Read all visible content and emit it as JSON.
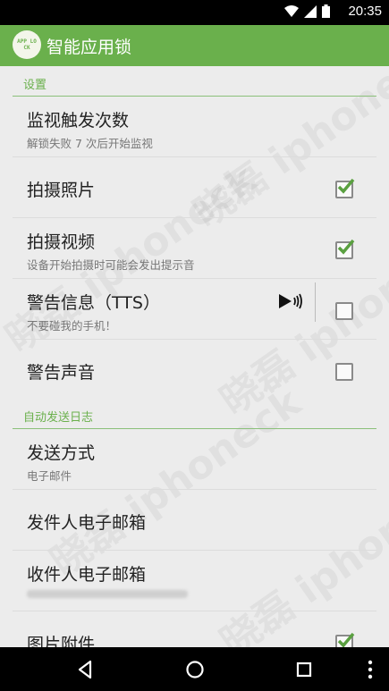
{
  "status": {
    "time": "20:35"
  },
  "app": {
    "title": "智能应用锁",
    "logo_text": "APP LOCK"
  },
  "sections": {
    "settings": "设置",
    "auto_log": "自动发送日志"
  },
  "rows": {
    "monitor": {
      "title": "监视触发次数",
      "summary": "解锁失败 7 次后开始监视"
    },
    "photo": {
      "title": "拍摄照片",
      "checked": true
    },
    "video": {
      "title": "拍摄视频",
      "summary": "设备开始拍摄时可能会发出提示音",
      "checked": true
    },
    "warning": {
      "title": "警告信息（TTS）",
      "summary": "不要碰我的手机！",
      "checked": false
    },
    "sound": {
      "title": "警告声音",
      "checked": false
    },
    "send_method": {
      "title": "发送方式",
      "summary": "电子邮件"
    },
    "sender": {
      "title": "发件人电子邮箱"
    },
    "recipient": {
      "title": "收件人电子邮箱"
    },
    "attachment": {
      "title": "图片附件",
      "checked": true
    }
  },
  "watermark": "晓磊 iphoneck",
  "colors": {
    "accent": "#6ab04c",
    "status_bar": "#000000",
    "nav_bar": "#000000"
  },
  "icons": [
    "wifi-icon",
    "signal-icon",
    "battery-icon",
    "back-icon",
    "home-icon",
    "recents-icon",
    "overflow-menu-icon",
    "speaker-icon"
  ]
}
